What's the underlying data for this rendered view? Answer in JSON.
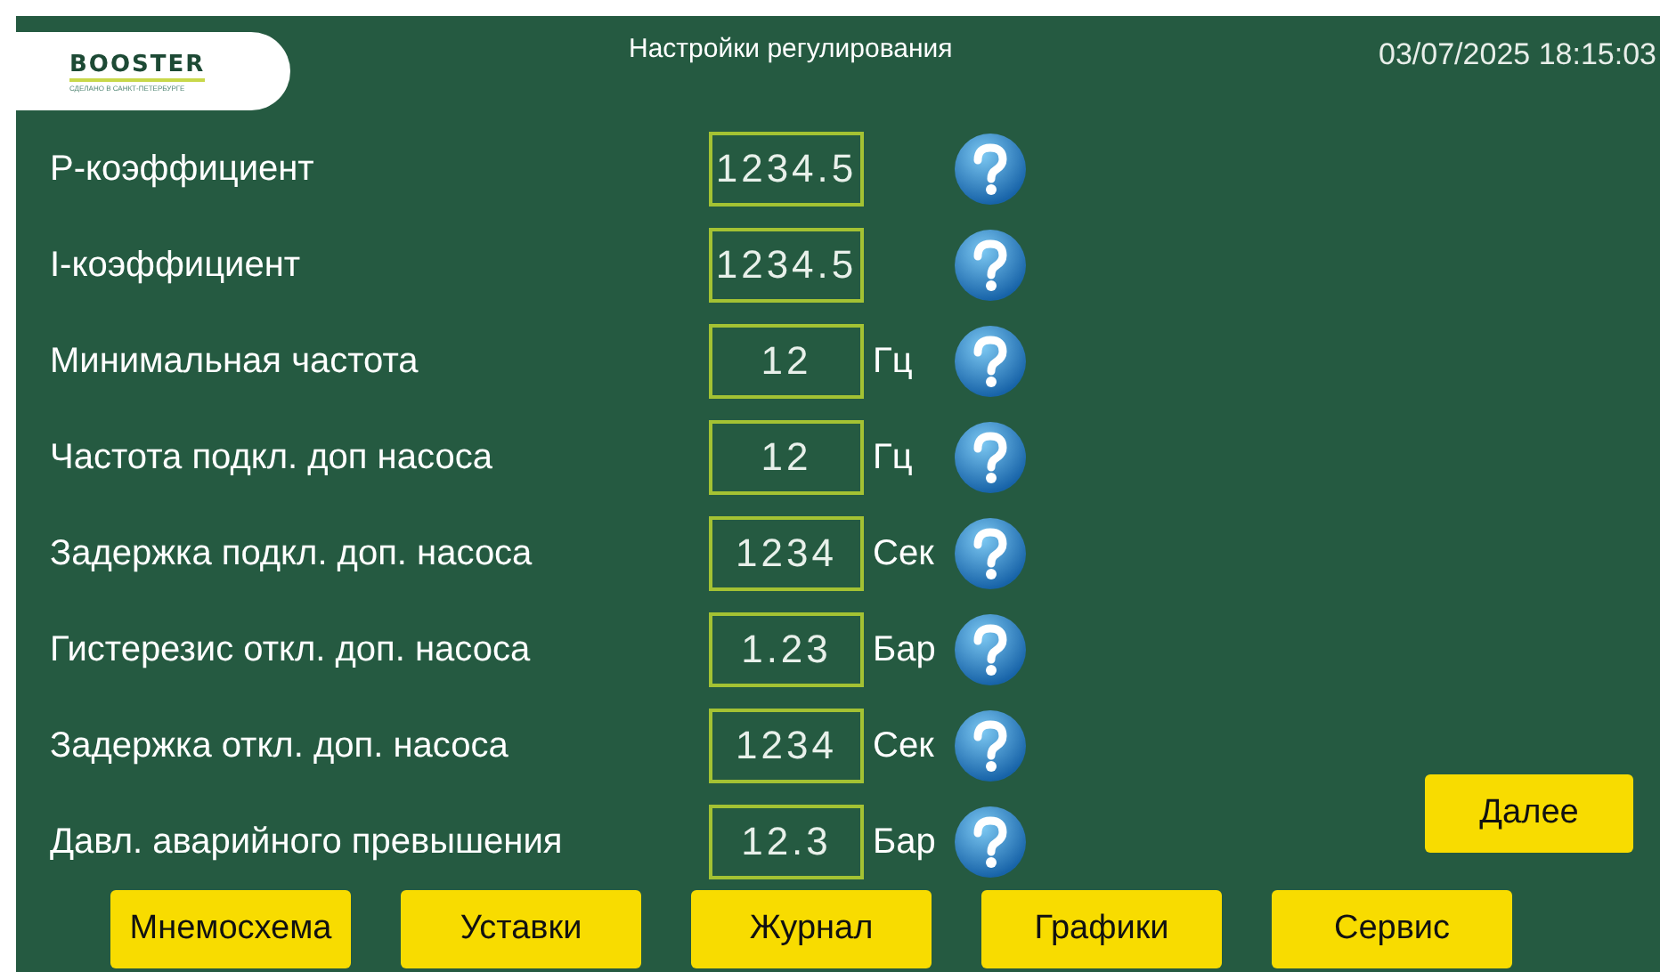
{
  "logo": {
    "brand": "BOOSTER",
    "tagline": "СДЕЛАНО В САНКТ-ПЕТЕРБУРГЕ"
  },
  "title": "Настройки регулирования",
  "datetime": "03/07/2025 18:15:03",
  "params": [
    {
      "label": "P-коэффициент",
      "value": "1234.5"
    },
    {
      "label": "I-коэффициент",
      "value": "1234.5"
    },
    {
      "label": "Минимальная частота",
      "value": "12",
      "unit": "Гц"
    },
    {
      "label": "Частота подкл. доп насоса",
      "value": "12",
      "unit": "Гц"
    },
    {
      "label": "Задержка подкл. доп. насоса",
      "value": "1234",
      "unit": "Сек"
    },
    {
      "label": "Гистерезис откл. доп. насоса",
      "value": "1.23",
      "unit": "Бар"
    },
    {
      "label": "Задержка откл. доп. насоса",
      "value": "1234",
      "unit": "Сек"
    },
    {
      "label": "Давл. аварийного превышения",
      "value": "12.3",
      "unit": "Бар"
    }
  ],
  "next_button": "Далее",
  "nav": [
    "Мнемосхема",
    "Уставки",
    "Журнал",
    "Графики",
    "Сервис"
  ]
}
